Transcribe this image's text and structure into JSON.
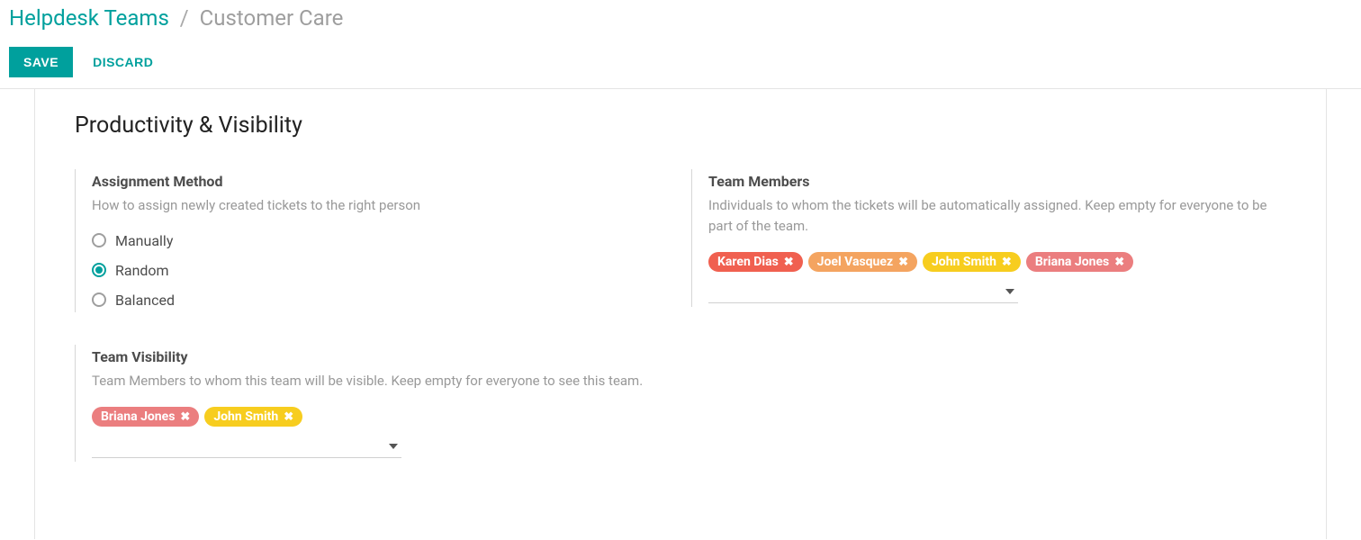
{
  "breadcrumb": {
    "root": "Helpdesk Teams",
    "separator": "/",
    "current": "Customer Care"
  },
  "toolbar": {
    "save_label": "SAVE",
    "discard_label": "DISCARD"
  },
  "section": {
    "title": "Productivity & Visibility"
  },
  "assignment_method": {
    "title": "Assignment Method",
    "desc": "How to assign newly created tickets to the right person",
    "options": [
      {
        "label": "Manually",
        "selected": false
      },
      {
        "label": "Random",
        "selected": true
      },
      {
        "label": "Balanced",
        "selected": false
      }
    ]
  },
  "team_visibility": {
    "title": "Team Visibility",
    "desc": "Team Members to whom this team will be visible. Keep empty for everyone to see this team.",
    "tags": [
      {
        "label": "Briana Jones",
        "color": "tag-pink"
      },
      {
        "label": "John Smith",
        "color": "tag-yellow"
      }
    ]
  },
  "team_members": {
    "title": "Team Members",
    "desc": "Individuals to whom the tickets will be automatically assigned. Keep empty for everyone to be part of the team.",
    "tags": [
      {
        "label": "Karen Dias",
        "color": "tag-red"
      },
      {
        "label": "Joel Vasquez",
        "color": "tag-orange"
      },
      {
        "label": "John Smith",
        "color": "tag-yellow"
      },
      {
        "label": "Briana Jones",
        "color": "tag-pink"
      }
    ]
  }
}
